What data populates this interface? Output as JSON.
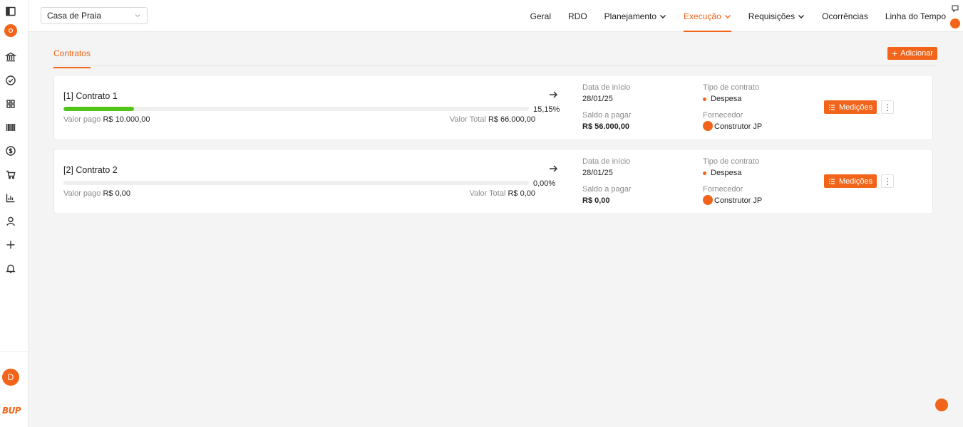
{
  "app": {
    "brand": "BUP",
    "avatar_letter": "D"
  },
  "project_select": {
    "value": "Casa de Praia"
  },
  "nav": [
    {
      "label": "Geral",
      "dropdown": false,
      "active": false
    },
    {
      "label": "RDO",
      "dropdown": false,
      "active": false
    },
    {
      "label": "Planejamento",
      "dropdown": true,
      "active": false
    },
    {
      "label": "Execução",
      "dropdown": true,
      "active": true
    },
    {
      "label": "Requisições",
      "dropdown": true,
      "active": false
    },
    {
      "label": "Ocorrências",
      "dropdown": false,
      "active": false
    },
    {
      "label": "Linha do Tempo",
      "dropdown": false,
      "active": false
    }
  ],
  "tabs": {
    "contracts": "Contratos"
  },
  "add_button": "Adicionar",
  "labels": {
    "paid": "Valor pago",
    "total": "Valor Total",
    "start_date": "Data de início",
    "balance": "Saldo a pagar",
    "contract_type": "Tipo de contrato",
    "supplier": "Fornecedor",
    "measurements": "Medições"
  },
  "contracts": [
    {
      "title": "[1] Contrato 1",
      "progress_pct": 15.15,
      "progress_label": "15,15%",
      "paid": "R$ 10.000,00",
      "total": "R$ 66.000,00",
      "start_date": "28/01/25",
      "balance": "R$ 56.000,00",
      "type": "Despesa",
      "supplier": "Construtor JP"
    },
    {
      "title": "[2] Contrato 2",
      "progress_pct": 0,
      "progress_label": "0,00%",
      "paid": "R$ 0,00",
      "total": "R$ 0,00",
      "start_date": "28/01/25",
      "balance": "R$ 0,00",
      "type": "Despesa",
      "supplier": "Construtor JP"
    }
  ],
  "colors": {
    "accent": "#f26419",
    "progress": "#52c41a"
  },
  "sidebar_icons": [
    "panel-toggle-icon",
    "brand-logo-icon",
    "bank-icon",
    "check-circle-icon",
    "grid-icon",
    "barcode-icon",
    "dollar-icon",
    "cart-icon",
    "chart-icon",
    "user-icon",
    "plus-icon",
    "bell-icon"
  ]
}
